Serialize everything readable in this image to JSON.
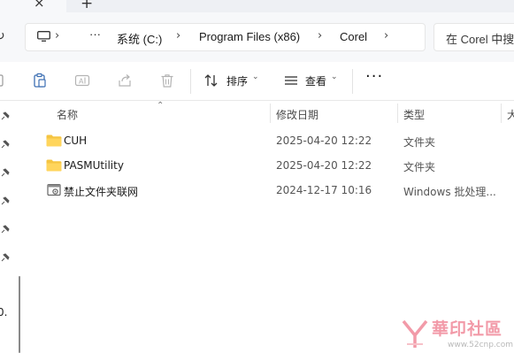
{
  "tabs": {
    "close_glyph": "×",
    "new_glyph": "+"
  },
  "address": {
    "crumbs": [
      "系统 (C:)",
      "Program Files (x86)",
      "Corel"
    ],
    "more_glyph": "···",
    "search_placeholder": "在 Corel 中搜"
  },
  "toolbar": {
    "sort_label": "排序",
    "view_label": "查看",
    "more_glyph": "···"
  },
  "columns": [
    "名称",
    "修改日期",
    "类型",
    "大"
  ],
  "files": [
    {
      "name": "CUH",
      "date": "2025-04-20 12:22",
      "type": "文件夹",
      "icon": "folder-icon"
    },
    {
      "name": "PASMUtility",
      "date": "2025-04-20 12:22",
      "type": "文件夹",
      "icon": "folder-icon"
    },
    {
      "name": "禁止文件夹联网",
      "date": "2024-12-17 10:16",
      "type": "Windows 批处理...",
      "icon": "batch-file-icon"
    }
  ],
  "nav_pane": {
    "version_text": "0."
  },
  "watermark": {
    "site_name": "華印社區",
    "url": "www.52cnp.com"
  },
  "colors": {
    "folder": "#f5c542",
    "accent": "#0067c0",
    "watermark": "#f29aa8"
  }
}
